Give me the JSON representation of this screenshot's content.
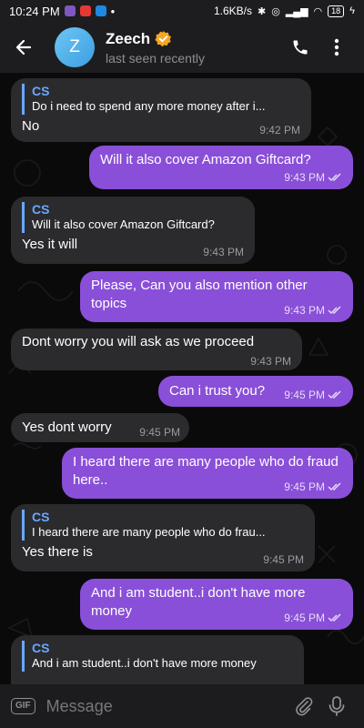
{
  "status_bar": {
    "time": "10:24 PM",
    "dot": "•",
    "net_speed": "1.6KB/s",
    "battery": "18",
    "app_icons": [
      "#7e57c2",
      "#e53935",
      "#1e88e5"
    ]
  },
  "header": {
    "avatar_letter": "Z",
    "name": "Zeech",
    "status": "last seen recently"
  },
  "messages": [
    {
      "side": "in",
      "reply_name": "CS",
      "reply_text": "Do i need to spend any more money after i...",
      "text": "No",
      "time": "9:42 PM"
    },
    {
      "side": "out",
      "text": "Will it also cover Amazon Giftcard?",
      "time": "9:43 PM",
      "ticks": "double"
    },
    {
      "side": "in",
      "reply_name": "CS",
      "reply_text": "Will it also cover Amazon Giftcard?",
      "text": "Yes it will",
      "time": "9:43 PM"
    },
    {
      "side": "out",
      "text": "Please, Can you also mention other topics",
      "time": "9:43 PM",
      "ticks": "double"
    },
    {
      "side": "in",
      "text": "Dont worry you will ask as we proceed",
      "time": "9:43 PM"
    },
    {
      "side": "out",
      "text": "Can i trust you?",
      "time": "9:45 PM",
      "ticks": "double"
    },
    {
      "side": "in",
      "text": "Yes dont worry",
      "time": "9:45 PM"
    },
    {
      "side": "out",
      "text": "I heard there are many people who do fraud here..",
      "time": "9:45 PM",
      "ticks": "double"
    },
    {
      "side": "in",
      "reply_name": "CS",
      "reply_text": "I heard there are many people who do frau...",
      "text": "Yes there is",
      "time": "9:45 PM"
    },
    {
      "side": "out",
      "text": "And i am student..i don't have more money",
      "time": "9:45 PM",
      "ticks": "double"
    },
    {
      "side": "in",
      "reply_name": "CS",
      "reply_text": "And i am student..i don't have more money",
      "text": "",
      "time": ""
    }
  ],
  "composer": {
    "gif_label": "GIF",
    "placeholder": "Message"
  },
  "colors": {
    "outgoing_bubble": "#8a4fd8",
    "incoming_bubble": "#2b2b2e",
    "reply_accent": "#6aa8ff"
  }
}
